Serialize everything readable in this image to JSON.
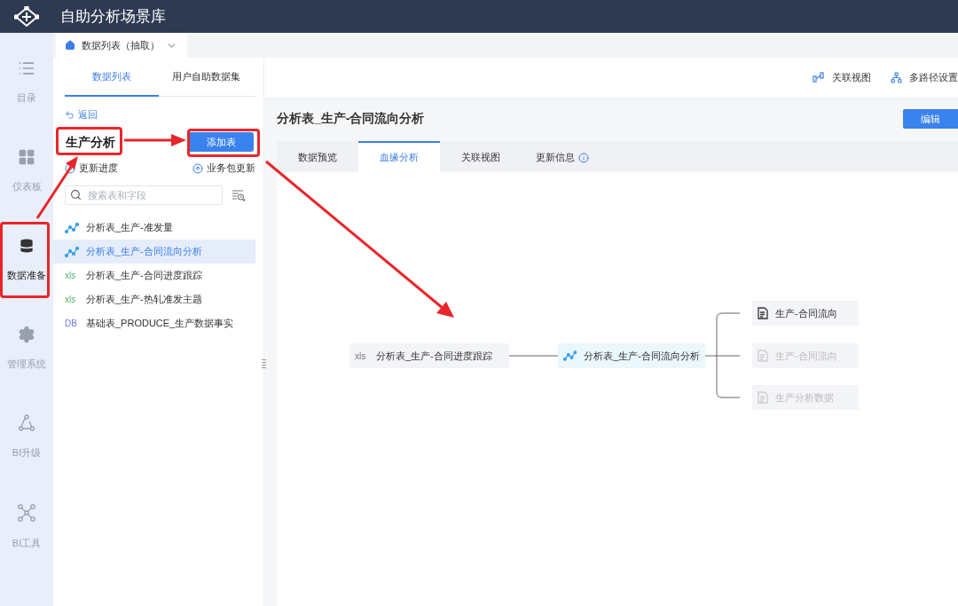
{
  "app_title": "自助分析场景库",
  "nav": [
    {
      "label": "目录",
      "selected": false
    },
    {
      "label": "仪表板",
      "selected": false
    },
    {
      "label": "数据准备",
      "selected": true
    },
    {
      "label": "管理系统",
      "selected": false
    },
    {
      "label": "BI升级",
      "selected": false
    },
    {
      "label": "BI工具",
      "selected": false
    }
  ],
  "page_tab": {
    "label": "数据列表（抽取）"
  },
  "panel_tabs": [
    {
      "label": "数据列表",
      "selected": true
    },
    {
      "label": "用户自助数据集",
      "selected": false
    }
  ],
  "top_actions": [
    {
      "label": "关联视图"
    },
    {
      "label": "多路径设置"
    }
  ],
  "back": "返回",
  "package_title": "生产分析",
  "add_button": "添加表",
  "package_actions": [
    {
      "label": "更新进度"
    },
    {
      "label": "业务包更新"
    }
  ],
  "search": {
    "placeholder": "搜索表和字段"
  },
  "tables": [
    {
      "kind": "analysis",
      "name": "分析表_生产-准发量",
      "selected": false
    },
    {
      "kind": "analysis",
      "name": "分析表_生产-合同流向分析",
      "selected": true
    },
    {
      "kind": "xls",
      "badge": "xls",
      "name": "分析表_生产-合同进度跟踪",
      "selected": false
    },
    {
      "kind": "xls",
      "badge": "xls",
      "name": "分析表_生产-热轧准发主题",
      "selected": false
    },
    {
      "kind": "db",
      "badge": "DB",
      "name": "基础表_PRODUCE_生产数据事实",
      "selected": false
    }
  ],
  "detail": {
    "title": "分析表_生产-合同流向分析",
    "edit_button": "编辑",
    "tabs": [
      {
        "label": "数据预览",
        "selected": false,
        "info": false
      },
      {
        "label": "血缘分析",
        "selected": true,
        "info": false
      },
      {
        "label": "关联视图",
        "selected": false,
        "info": false
      },
      {
        "label": "更新信息",
        "selected": false,
        "info": true
      }
    ],
    "lineage": {
      "source": {
        "badge": "xls",
        "name": "分析表_生产-合同进度跟踪"
      },
      "current": {
        "name": "分析表_生产-合同流向分析"
      },
      "outputs": [
        {
          "name": "生产-合同流向",
          "disabled": false
        },
        {
          "name": "生产-合同流向",
          "disabled": true
        },
        {
          "name": "生产分析数据",
          "disabled": true
        }
      ]
    }
  }
}
